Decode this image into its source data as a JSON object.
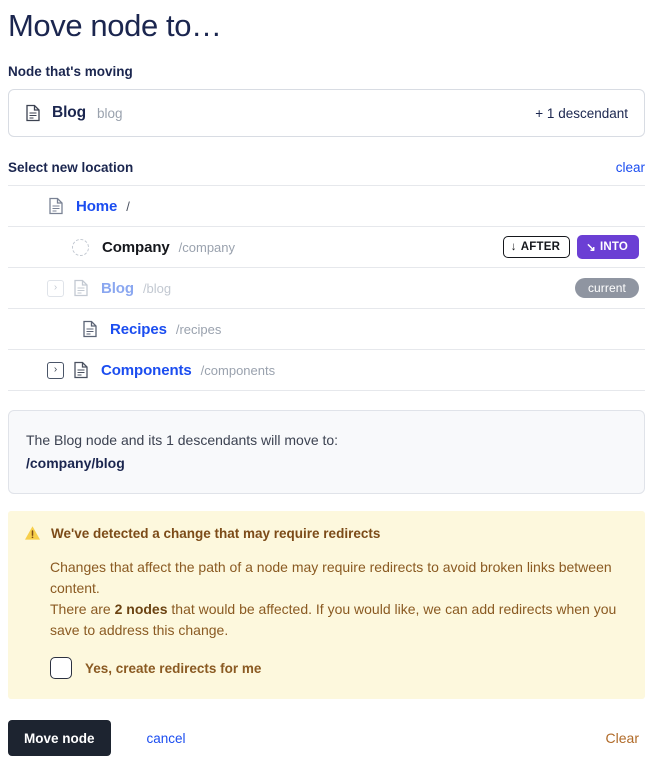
{
  "dialog": {
    "title": "Move node to…"
  },
  "moving_section": {
    "label": "Node that's moving",
    "node": {
      "icon": "document-icon",
      "name": "Blog",
      "slug": "blog",
      "descendants_text": "+ 1 descendant"
    }
  },
  "location_section": {
    "label": "Select new location",
    "clear_label": "clear",
    "rows": [
      {
        "name": "Home",
        "path": "/",
        "indent": 0,
        "icon": "document-icon",
        "expander": "none",
        "state": "link",
        "actions": []
      },
      {
        "name": "Company",
        "path": "/company",
        "indent": 1,
        "icon": "dotted-circle-placeholder",
        "expander": "none",
        "state": "active",
        "actions": [
          {
            "id": "after",
            "label": "AFTER",
            "icon": "arrow-down-icon"
          },
          {
            "id": "into",
            "label": "INTO",
            "icon": "arrow-down-right-icon"
          }
        ]
      },
      {
        "name": "Blog",
        "path": "/blog",
        "indent": 1,
        "icon": "document-icon",
        "expander": "faded",
        "state": "faded",
        "badge": "current",
        "actions": []
      },
      {
        "name": "Recipes",
        "path": "/recipes",
        "indent": 2,
        "icon": "document-icon",
        "expander": "none",
        "state": "link",
        "actions": []
      },
      {
        "name": "Components",
        "path": "/components",
        "indent": 1,
        "icon": "document-icon",
        "expander": "dark",
        "state": "link",
        "actions": []
      }
    ]
  },
  "info_box": {
    "line1": "The Blog node and its 1 descendants will move to:",
    "line2": "/company/blog"
  },
  "warning": {
    "icon": "warning-triangle-icon",
    "title": "We've detected a change that may require redirects",
    "paragraph1": "Changes that affect the path of a node may require redirects to avoid broken links between content.",
    "sentence_prefix": "There are ",
    "sentence_bold": "2 nodes",
    "sentence_suffix": " that would be affected. If you would like, we can add redirects when you save to address this change.",
    "checkbox_label": "Yes, create redirects for me",
    "checkbox_checked": false
  },
  "footer": {
    "primary_label": "Move node",
    "cancel_label": "cancel",
    "clear_label": "Clear"
  },
  "colors": {
    "link_blue": "#1b4df0",
    "into_purple": "#6b3fd4",
    "warning_bg": "#fdf8dd",
    "warning_text": "#8a5a22",
    "badge_gray": "#8f95a1",
    "primary_dark": "#1d2430",
    "clear_orange": "#b06a28"
  }
}
